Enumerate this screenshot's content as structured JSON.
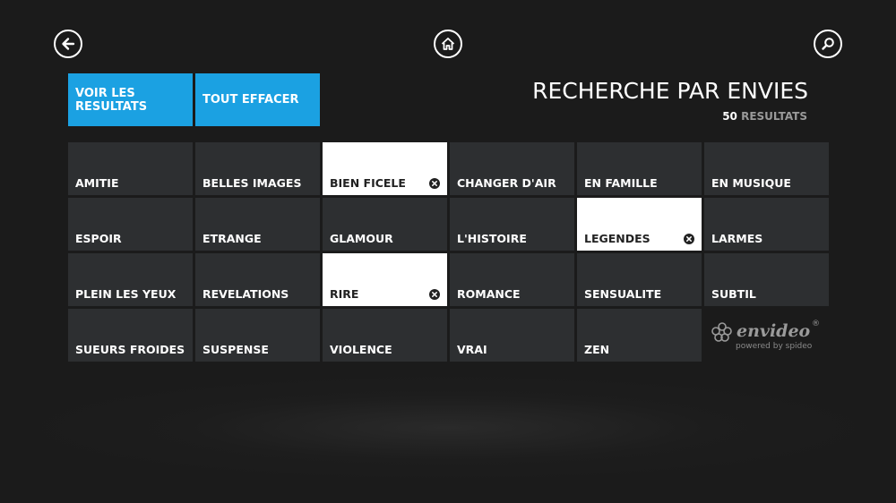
{
  "nav": {
    "back_icon": "arrow-left-icon",
    "home_icon": "home-icon",
    "search_icon": "search-icon"
  },
  "actions": {
    "show_results": "VOIR LES RESULTATS",
    "clear_all": "TOUT EFFACER"
  },
  "header": {
    "title": "RECHERCHE PAR ENVIES",
    "count": "50",
    "count_label": "RESULTATS"
  },
  "colors": {
    "accent": "#1ba1e2",
    "tile": "#2d2f31",
    "tile_selected": "#ffffff",
    "background": "#1b1b1b"
  },
  "tags": [
    {
      "label": "AMITIE",
      "selected": false
    },
    {
      "label": "BELLES IMAGES",
      "selected": false
    },
    {
      "label": "BIEN FICELE",
      "selected": true
    },
    {
      "label": "CHANGER D'AIR",
      "selected": false
    },
    {
      "label": "EN FAMILLE",
      "selected": false
    },
    {
      "label": "EN MUSIQUE",
      "selected": false
    },
    {
      "label": "ESPOIR",
      "selected": false
    },
    {
      "label": "ETRANGE",
      "selected": false
    },
    {
      "label": "GLAMOUR",
      "selected": false
    },
    {
      "label": "L'HISTOIRE",
      "selected": false
    },
    {
      "label": "LEGENDES",
      "selected": true
    },
    {
      "label": "LARMES",
      "selected": false
    },
    {
      "label": "PLEIN LES YEUX",
      "selected": false
    },
    {
      "label": "REVELATIONS",
      "selected": false
    },
    {
      "label": "RIRE",
      "selected": true
    },
    {
      "label": "ROMANCE",
      "selected": false
    },
    {
      "label": "SENSUALITE",
      "selected": false
    },
    {
      "label": "SUBTIL",
      "selected": false
    },
    {
      "label": "SUEURS FROIDES",
      "selected": false
    },
    {
      "label": "SUSPENSE",
      "selected": false
    },
    {
      "label": "VIOLENCE",
      "selected": false
    },
    {
      "label": "VRAI",
      "selected": false
    },
    {
      "label": "ZEN",
      "selected": false
    }
  ],
  "logo": {
    "name": "envideo",
    "reg": "®",
    "tagline": "powered by spideo"
  }
}
